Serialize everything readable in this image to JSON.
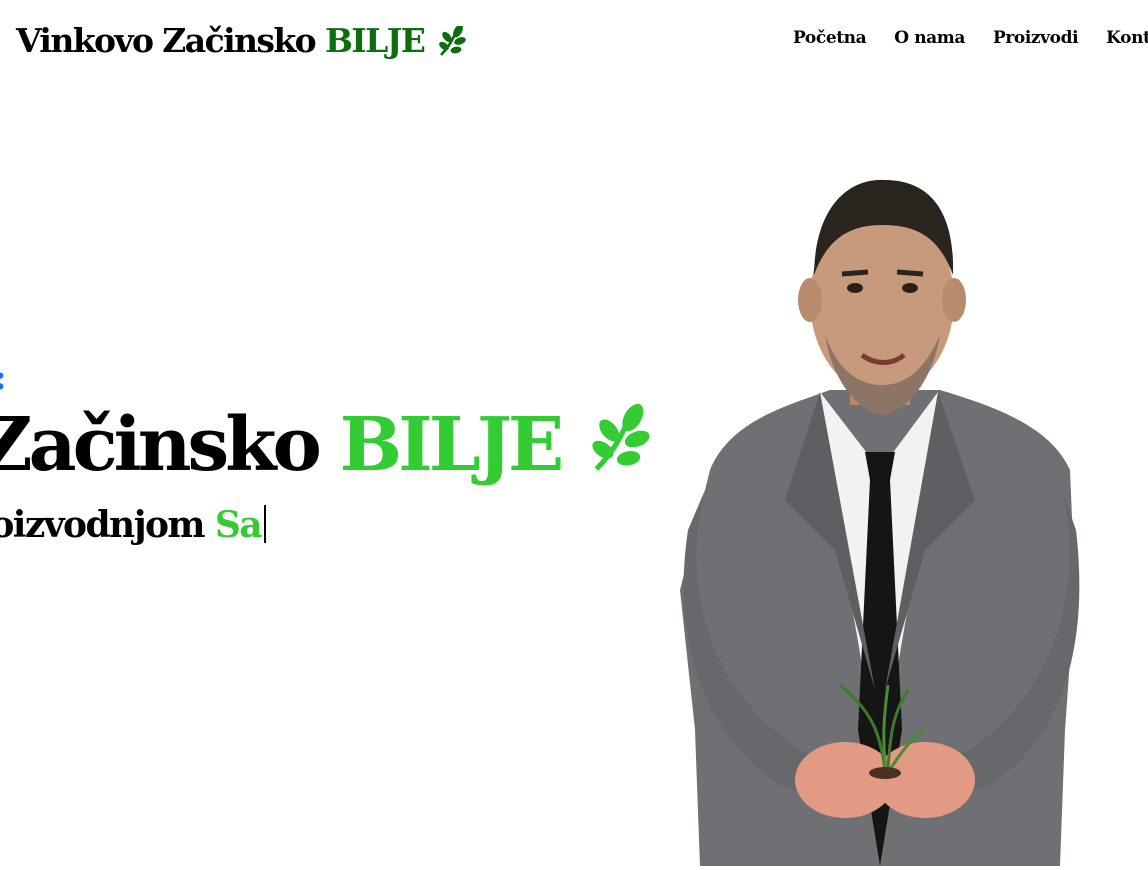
{
  "header": {
    "logo_main": "Vinkovo Začinsko",
    "logo_accent": "BILJE",
    "logo_icon": "herb-sprig-icon",
    "nav": [
      {
        "label": "Početna"
      },
      {
        "label": "O nama"
      },
      {
        "label": "Proizvodi"
      },
      {
        "label": "Kontak"
      }
    ]
  },
  "hero": {
    "eyebrow": ":",
    "headline_main": "o Začinsko",
    "headline_accent": "BILJE",
    "subline_main": "oizvodnjom",
    "subline_typed": "Sa",
    "icon": "herb-sprig-icon"
  },
  "colors": {
    "logo_accent": "#0d6e0d",
    "hero_accent": "#33cc33",
    "eyebrow": "#1a73e8"
  }
}
